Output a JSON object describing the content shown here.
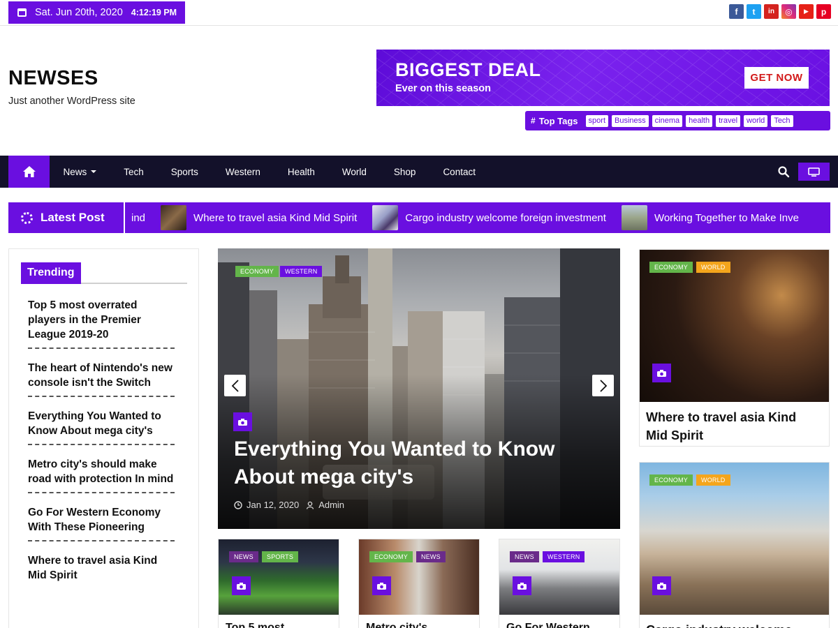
{
  "topbar": {
    "date": "Sat. Jun 20th, 2020",
    "time": "4:12:19 PM",
    "socials": [
      {
        "icon": "facebook-icon",
        "glyph": "f",
        "color": "#3b5998"
      },
      {
        "icon": "twitter-icon",
        "glyph": "t",
        "color": "#1da1f2"
      },
      {
        "icon": "linkedin-icon",
        "glyph": "in",
        "color": "#d4231f"
      },
      {
        "icon": "instagram-icon",
        "glyph": "◎",
        "color": "#c13584"
      },
      {
        "icon": "youtube-icon",
        "glyph": "▶",
        "color": "#e62117"
      },
      {
        "icon": "pinterest-icon",
        "glyph": "p",
        "color": "#e60023"
      }
    ]
  },
  "header": {
    "site_title": "NEWSES",
    "site_desc": "Just another WordPress site",
    "ad": {
      "title": "BIGGEST DEAL",
      "subtitle": "Ever on this season",
      "button": "GET NOW"
    },
    "top_tags_label": "Top Tags",
    "tags": [
      "sport",
      "Business",
      "cinema",
      "health",
      "travel",
      "world",
      "Tech"
    ]
  },
  "nav": {
    "items": [
      "News",
      "Tech",
      "Sports",
      "Western",
      "Health",
      "World",
      "Shop",
      "Contact"
    ]
  },
  "ticker": {
    "label": "Latest Post",
    "lead_fragment": "ind",
    "items": [
      "Where to travel asia Kind Mid Spirit",
      "Cargo industry welcome foreign investment",
      "Working Together to Make Inve"
    ]
  },
  "trending": {
    "title": "Trending",
    "items": [
      "Top 5 most overrated players in the Premier League 2019-20",
      "The heart of Nintendo's new console isn't the Switch",
      "Everything You Wanted to Know About mega city's",
      "Metro city's should make road with protection In mind",
      "Go For Western Economy With These Pioneering",
      "Where to travel asia Kind Mid Spirit"
    ]
  },
  "hero": {
    "cats": [
      "ECONOMY",
      "WESTERN"
    ],
    "title": "Everything You Wanted to Know About mega city's",
    "date": "Jan 12, 2020",
    "author": "Admin"
  },
  "small_cards": [
    {
      "cats": [
        "NEWS",
        "SPORTS"
      ],
      "title": "Top 5 most"
    },
    {
      "cats": [
        "ECONOMY",
        "NEWS"
      ],
      "title": "Metro city's"
    },
    {
      "cats": [
        "NEWS",
        "WESTERN"
      ],
      "title": "Go For Western"
    }
  ],
  "right_cards": [
    {
      "cats": [
        "ECONOMY",
        "WORLD"
      ],
      "title": "Where to travel asia Kind Mid Spirit"
    },
    {
      "cats": [
        "ECONOMY",
        "WORLD"
      ],
      "title": "Cargo industry welcome"
    }
  ],
  "colors": {
    "accent": "#6a0fe0",
    "nav_bg": "#13112a",
    "cat_green": "#63b54a",
    "cat_orange": "#f4a51c"
  }
}
